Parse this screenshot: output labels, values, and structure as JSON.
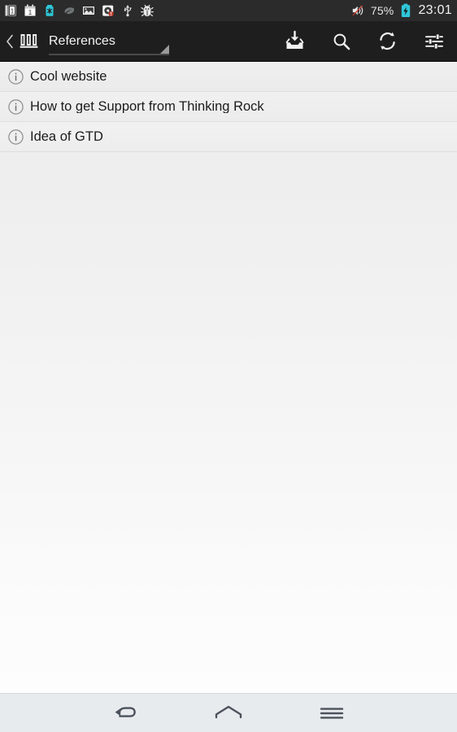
{
  "status_bar": {
    "background": "#2b2b2b",
    "left_icons": [
      {
        "name": "calendar-day-1-icon",
        "label": "1"
      },
      {
        "name": "calendar-date-icon",
        "label": "1"
      },
      {
        "name": "battery-saver-icon",
        "label": ""
      },
      {
        "name": "leaf-icon",
        "label": ""
      },
      {
        "name": "image-gallery-icon",
        "label": ""
      },
      {
        "name": "storage-alert-icon",
        "label": ""
      },
      {
        "name": "usb-icon",
        "label": ""
      },
      {
        "name": "bug-debug-icon",
        "label": ""
      }
    ],
    "right": {
      "volume_icon": "volume-mute-icon",
      "battery_percent": "75%",
      "battery_icon": "battery-charging-icon",
      "battery_color": "#2ec8d8",
      "clock": "23:01"
    }
  },
  "action_bar": {
    "background": "#1e1e1e",
    "back_icon": "back-chevron-icon",
    "app_icon": "library-books-icon",
    "spinner": {
      "selected": "References",
      "caret_icon": "spinner-caret-icon",
      "options": [
        "References"
      ]
    },
    "actions": [
      {
        "name": "collect-inbox-button",
        "icon": "inbox-download-icon",
        "label": "Collect"
      },
      {
        "name": "search-button",
        "icon": "search-icon",
        "label": "Search"
      },
      {
        "name": "sync-button",
        "icon": "sync-refresh-icon",
        "label": "Sync"
      },
      {
        "name": "settings-button",
        "icon": "tune-sliders-icon",
        "label": "Settings"
      }
    ]
  },
  "list": {
    "item_icon": "info-circle-icon",
    "items": [
      {
        "title": "Cool website"
      },
      {
        "title": "How to get Support from Thinking Rock"
      },
      {
        "title": "Idea of GTD"
      }
    ]
  },
  "nav_bar": {
    "background": "#e8ebee",
    "buttons": [
      {
        "name": "nav-back-button",
        "icon": "nav-back-arrow-icon",
        "label": "Back"
      },
      {
        "name": "nav-home-button",
        "icon": "nav-home-icon",
        "label": "Home"
      },
      {
        "name": "nav-recents-button",
        "icon": "nav-recents-icon",
        "label": "Recent apps"
      }
    ]
  }
}
